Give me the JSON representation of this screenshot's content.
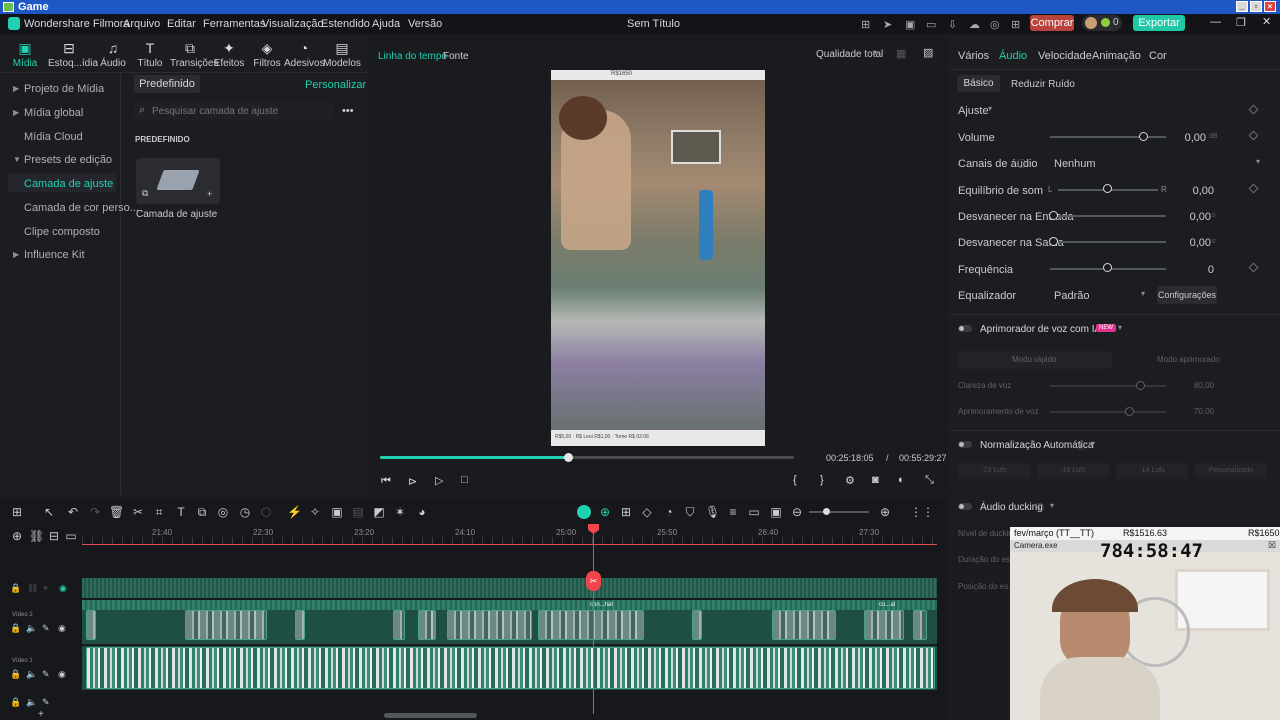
{
  "os": {
    "title": "Game"
  },
  "app": {
    "name": "Wondershare Filmora",
    "project": "Sem Título",
    "menu": [
      "Arquivo",
      "Editar",
      "Ferramentas",
      "Visualização",
      "Estendido",
      "Ajuda",
      "Versão"
    ],
    "buy_label": "Comprar",
    "export_label": "Exportar",
    "credits": "0"
  },
  "toolbar": [
    "Mídia",
    "Estoq...ídia",
    "Áudio",
    "Título",
    "Transições",
    "Efeitos",
    "Filtros",
    "Adesivos",
    "Modelos"
  ],
  "left_panel": {
    "items": [
      "Projeto de Mídia",
      "Mídia global",
      "Mídia Cloud",
      "Presets de edição",
      "Camada de ajuste",
      "Camada de cor perso...",
      "Clipe composto",
      "Influence Kit"
    ],
    "tab_preset": "Predefinido",
    "personalize": "Personalizar",
    "search_placeholder": "Pesquisar camada de ajuste",
    "section": "PREDEFINIDO",
    "card_label": "Camada de ajuste"
  },
  "player": {
    "tab_timeline": "Linha do tempo",
    "tab_source": "Fonte",
    "quality": "Qualidade total",
    "current_time": "00:25:18:05",
    "separator": "/",
    "total_time": "00:55:29:27",
    "progress": 0.455,
    "frame_top_text": "R$1650",
    "frame_bottom_text": "R$5,00 · R$ Leoi R$1,00 · Torne R$ 02:06"
  },
  "right_panel": {
    "tabs": [
      "Vários",
      "Áudio",
      "Velocidade",
      "Animação",
      "Cor"
    ],
    "subtabs": [
      "Básico",
      "Reduzir Ruído"
    ],
    "section_adjust": "Ajuste",
    "volume_label": "Volume",
    "volume_value": "0,00",
    "volume_unit": "dB",
    "channels_label": "Canais de áudio",
    "channels_value": "Nenhum",
    "balance_label": "Equilíbrio de som",
    "balance_L": "L",
    "balance_R": "R",
    "balance_value": "0,00",
    "fadein_label": "Desvanecer na Entrada",
    "fadein_value": "0,00",
    "fadein_unit": "s",
    "fadeout_label": "Desvanecer na Saída",
    "fadeout_value": "0,00",
    "fadeout_unit": "s",
    "freq_label": "Frequência",
    "freq_value": "0",
    "eq_label": "Equalizador",
    "eq_value": "Padrão",
    "eq_settings": "Configurações",
    "voice_enhancer": "Aprimorador de voz com IA",
    "new_badge": "NEW",
    "mode_fast": "Modo rápido",
    "mode_enhanced": "Modo aprimorado",
    "clarity_label": "Clareza de voz",
    "clarity_value": "80,00",
    "enhance_label": "Aprimoramento de voz",
    "enhance_value": "70,00",
    "auto_norm": "Normalização Automática",
    "lufs": [
      "-23 Lufs",
      "-18 Lufs",
      "-14 Lufs",
      "Personalizado"
    ],
    "ducking": "Áudio ducking",
    "duck_level": "Nível de ducking",
    "duck_duration": "Duração do es...",
    "duck_position": "Posição do es..."
  },
  "timeline": {
    "ruler": [
      "21:40",
      "22:30",
      "23:20",
      "24:10",
      "25:00",
      "25:50",
      "26:40",
      "27:30"
    ],
    "track2_label": "Vídeo 2",
    "track1_label": "Vídeo 1",
    "clip_labels": [
      "con...hat",
      "co...at"
    ]
  },
  "webcam": {
    "title": "fev/março (TT__TT)",
    "amount": "R$1516.63",
    "amount2": "R$1650",
    "sub": "Camera.exe",
    "timer": "784:58:47"
  },
  "colors": {
    "accent": "#1fd1b0",
    "export": "#21c8a6",
    "buy": "#b8433c",
    "playhead": "#f2444b"
  }
}
